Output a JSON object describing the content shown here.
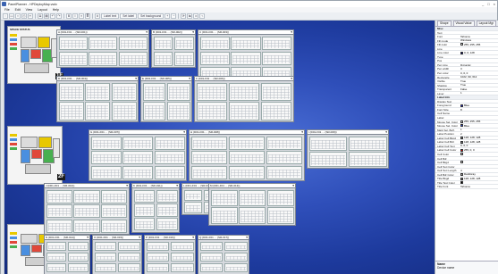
{
  "window": {
    "title": "PanelPlanner - HPDeployMap.vsdx",
    "controls": [
      "_",
      "□",
      "×"
    ]
  },
  "menu": [
    "File",
    "Edit",
    "View",
    "Layout",
    "Help"
  ],
  "toolbar": {
    "buttons": [
      "new",
      "open",
      "save",
      "print",
      "cut",
      "copy",
      "paste",
      "undo",
      "redo",
      "bold",
      "italic",
      "align-left",
      "align-center",
      "grid",
      "zoom-in",
      "zoom-out",
      "rotate",
      "flip",
      "link",
      "unlink"
    ],
    "label_field": "Label text",
    "combo": "Set label",
    "combo2": "Set background"
  },
  "floors": [
    {
      "label": "1",
      "legend_title": "SPACE STATUS",
      "legend_colors": [
        "#e8c800",
        "#4a8fe0",
        "#e0483a",
        "#48b050"
      ]
    },
    {
      "label": "2",
      "legend_title": "",
      "legend_colors": [
        "#e8c800",
        "#4a8fe0",
        "#e0483a",
        "#48b050"
      ]
    },
    {
      "label": "3",
      "legend_title": "",
      "legend_colors": [
        "#e8c800",
        "#4a8fe0",
        "#e0483a",
        "#48b050"
      ]
    }
  ],
  "groups": [
    {
      "title": "A  (D01-F01 ... (SR-001))",
      "panels": 6
    },
    {
      "title": "B  (D01-F01 ... (SR-002))",
      "panels": 4
    },
    {
      "title": "C  (D01-F01 ... (SR-003))",
      "panels": 6
    },
    {
      "title": "D  (D01-F01 ... (SR-004))",
      "panels": 6
    },
    {
      "title": "E  (D01-F01 ... (SR-005))",
      "panels": 6
    },
    {
      "title": "F  (D01-F01 ... (SR-006))",
      "panels": 6
    },
    {
      "title": "G  (D01-F01 ... (SR-007))",
      "panels": 6
    },
    {
      "title": "H  (D01-F01 ... (SR-008))",
      "panels": 6
    },
    {
      "title": "I  (D01-F01 ... (SR-009))",
      "panels": 6
    },
    {
      "title": "J  (D01-F01 ... (SR-010))",
      "panels": 6
    },
    {
      "title": "K  (D01-F01 ... (SR-011))",
      "panels": 6
    },
    {
      "title": "L  (D01-F01 ... (SR-012))",
      "panels": 6
    },
    {
      "title": "M  (D01-F01 ... (SR-013))",
      "panels": 4
    },
    {
      "title": "N  (D01-F01 ... (SR-014))",
      "panels": 4
    },
    {
      "title": "O  (D01-F01 ... (SR-015))",
      "panels": 4
    },
    {
      "title": "P  (D01-F01 ... (SR-016))",
      "panels": 4
    },
    {
      "title": "Q  (D01-F01 ... (SR-017))",
      "panels": 4
    }
  ],
  "properties": {
    "tabs": [
      "Shape",
      "Visual Value",
      "Layout Mgr"
    ],
    "rows": [
      {
        "k": "Misc",
        "v": "",
        "cat": true
      },
      {
        "k": "Text",
        "v": ""
      },
      {
        "k": "Font",
        "v": "Tahoma"
      },
      {
        "k": "Fill mode",
        "v": "Windows"
      },
      {
        "k": "Fill color",
        "v": "255, 255, 255",
        "sw": "#ffffff"
      },
      {
        "k": "Line",
        "v": ""
      },
      {
        "k": "Line color",
        "v": "0, 0, 128",
        "sw": "#000080"
      },
      {
        "k": "Type",
        "v": ""
      },
      {
        "k": "Pos",
        "v": ""
      },
      {
        "k": "Pen type",
        "v": "Dynamic"
      },
      {
        "k": "Pen width",
        "v": "3"
      },
      {
        "k": "Pen color",
        "v": "0, 0, 0"
      },
      {
        "k": "Rectangle",
        "v": "1022, 90, 612"
      },
      {
        "k": "Visible",
        "v": "True"
      },
      {
        "k": "Shadow",
        "v": "True"
      },
      {
        "k": "Transparent",
        "v": "False"
      },
      {
        "k": "Layer",
        "v": "1"
      },
      {
        "k": "Label Info",
        "v": "",
        "cat": true
      },
      {
        "k": "Display Text",
        "v": ""
      },
      {
        "k": "Foreground",
        "v": "Blue",
        "sw": "#1a1aff"
      },
      {
        "k": "Font Size",
        "v": "8"
      },
      {
        "k": "Cell Name",
        "v": ""
      },
      {
        "k": "Label",
        "v": ""
      },
      {
        "k": "Mouse Sel. Color",
        "v": "255, 255, 255",
        "sw": "#ffffff"
      },
      {
        "k": "Mouse Sel. Color",
        "v": "Blue",
        "sw": "#2244ff"
      },
      {
        "k": "Mark Sel. Buff.",
        "v": "1"
      },
      {
        "k": "Label Position",
        "v": "2"
      },
      {
        "k": "Label Cell Bkgd",
        "v": "128, 128, 128",
        "sw": "#808080"
      },
      {
        "k": "Label Cell Bdr",
        "v": "128, 128, 128",
        "sw": "#808080"
      },
      {
        "k": "Label Cell Text",
        "v": "0, 0, 0"
      },
      {
        "k": "Label Cell Color",
        "v": "255, 0, 0",
        "sw": "#ff0000"
      },
      {
        "k": "Cell Color",
        "v": "",
        "sw": "#ffffff"
      },
      {
        "k": "Cell Bdr",
        "v": ""
      },
      {
        "k": "Cell Bkgd",
        "v": "",
        "sw": "#ffffff"
      },
      {
        "k": "Cell Text Color",
        "v": ""
      },
      {
        "k": "Cell Text Length",
        "v": "4"
      },
      {
        "k": "Cell Bdr Color",
        "v": "DarkGray",
        "sw": "#a9a9a9"
      },
      {
        "k": "Title Bkgd",
        "v": "128, 128, 128",
        "sw": "#808080"
      },
      {
        "k": "Title Text Color",
        "v": "",
        "sw": "#000000"
      },
      {
        "k": "Title Font",
        "v": "Tahoma"
      }
    ],
    "desc_title": "Name",
    "desc_text": "Device name"
  }
}
